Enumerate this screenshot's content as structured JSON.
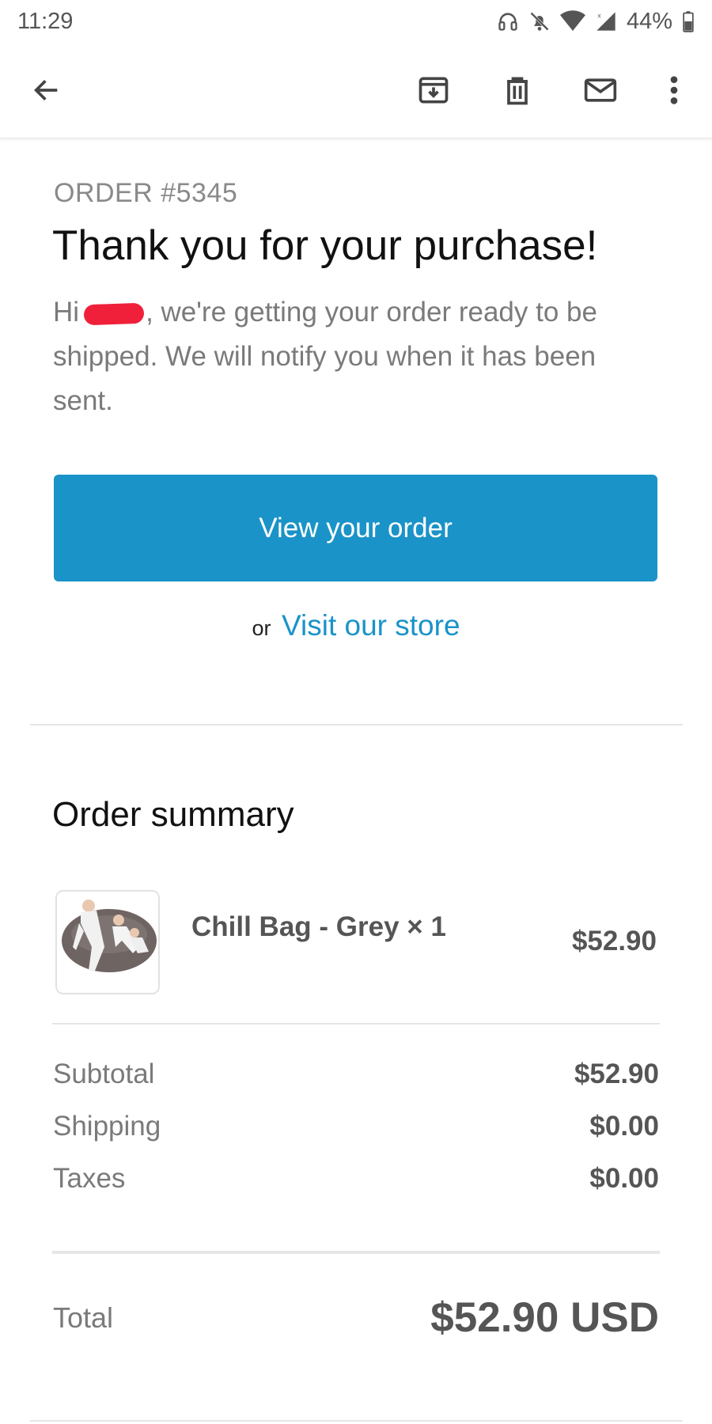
{
  "status_bar": {
    "time": "11:29",
    "battery": "44%",
    "icons": [
      "headphones-icon",
      "bell-off-icon",
      "wifi-icon",
      "signal-icon",
      "battery-icon"
    ]
  },
  "app_bar": {
    "icons": [
      "back-arrow-icon",
      "archive-icon",
      "delete-icon",
      "mark-unread-icon",
      "more-vert-icon"
    ]
  },
  "email": {
    "order_number": "ORDER #5345",
    "headline": "Thank you for your purchase!",
    "greeting_prefix": "Hi",
    "greeting_rest": ", we're getting your order ready to be shipped. We will notify you when it has been sent.",
    "cta_label": "View your order",
    "or_text": "or",
    "store_link": "Visit our store"
  },
  "summary": {
    "title": "Order summary",
    "items": [
      {
        "name": "Chill Bag - Grey × 1",
        "price": "$52.90"
      }
    ],
    "costs": [
      {
        "label": "Subtotal",
        "value": "$52.90"
      },
      {
        "label": "Shipping",
        "value": "$0.00"
      },
      {
        "label": "Taxes",
        "value": "$0.00"
      }
    ],
    "total_label": "Total",
    "total_value": "$52.90 USD"
  },
  "colors": {
    "accent": "#1a93c8",
    "redaction": "#f0203a"
  }
}
